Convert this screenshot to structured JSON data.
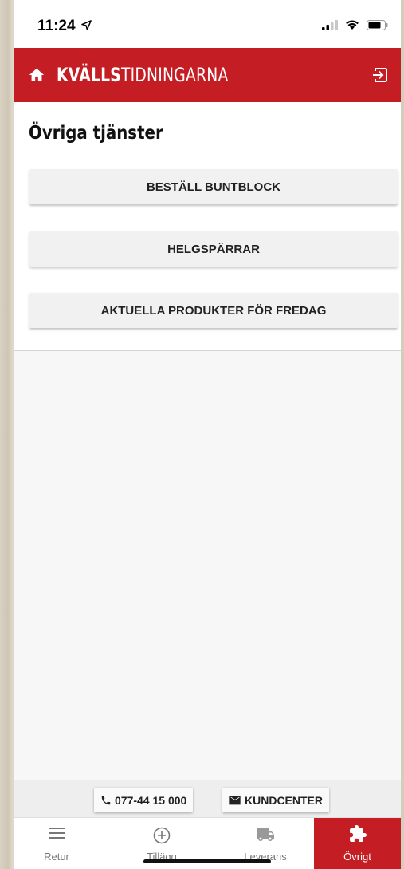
{
  "status_bar": {
    "time": "11:24"
  },
  "app_bar": {
    "brand_bold": "KVÄLLS",
    "brand_light": "TIDNINGARNA",
    "home_icon": "home-icon",
    "logout_icon": "logout-icon"
  },
  "page": {
    "title": "Övriga tjänster",
    "buttons": [
      {
        "label": "BESTÄLL BUNTBLOCK"
      },
      {
        "label": "HELGSPÄRRAR"
      },
      {
        "label": "AKTUELLA PRODUKTER FÖR FREDAG"
      }
    ]
  },
  "contact": {
    "phone": "077-44 15 000",
    "email_label": "KUNDCENTER"
  },
  "bottom_nav": {
    "items": [
      {
        "label": "Retur",
        "icon": "menu-icon"
      },
      {
        "label": "Tillägg",
        "icon": "add-circle-icon"
      },
      {
        "label": "Leverans",
        "icon": "truck-icon"
      },
      {
        "label": "Övrigt",
        "icon": "puzzle-icon"
      }
    ],
    "active_index": 3
  },
  "colors": {
    "brand_red": "#c41e24"
  }
}
